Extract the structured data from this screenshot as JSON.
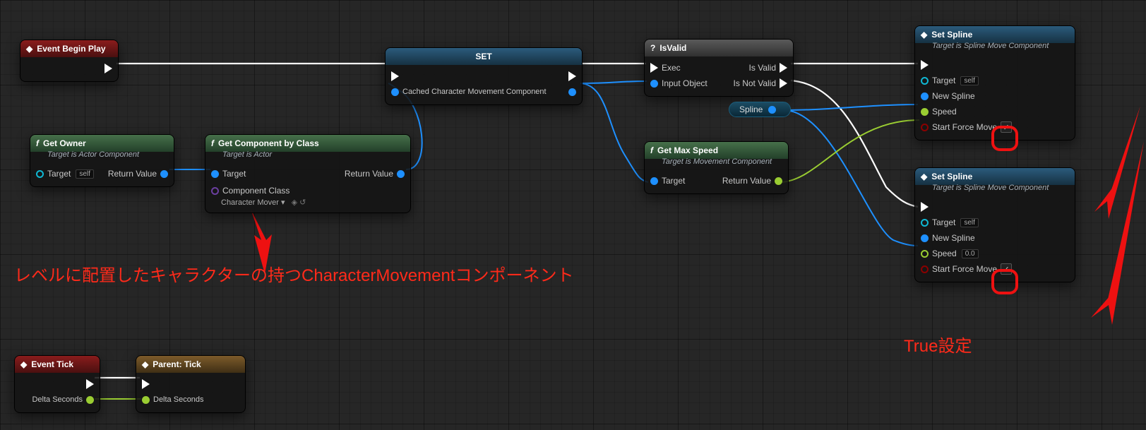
{
  "nodes": {
    "eventBeginPlay": {
      "title": "Event Begin Play"
    },
    "getOwner": {
      "title": "Get Owner",
      "subtitle": "Target is Actor Component",
      "targetLabel": "Target",
      "selfBadge": "self",
      "returnLabel": "Return Value"
    },
    "getComponent": {
      "title": "Get Component by Class",
      "subtitle": "Target is Actor",
      "targetLabel": "Target",
      "classLabel": "Component Class",
      "classValue": "Character Mover",
      "returnLabel": "Return Value"
    },
    "set": {
      "title": "SET",
      "varLabel": "Cached Character Movement Component"
    },
    "isValid": {
      "title": "IsValid",
      "execLabel": "Exec",
      "inputLabel": "Input Object",
      "validLabel": "Is Valid",
      "notValidLabel": "Is Not Valid"
    },
    "splineChip": {
      "label": "Spline"
    },
    "getMaxSpeed": {
      "title": "Get Max Speed",
      "subtitle": "Target is Movement Component",
      "targetLabel": "Target",
      "returnLabel": "Return Value"
    },
    "setSpline1": {
      "title": "Set Spline",
      "subtitle": "Target is Spline Move Component",
      "targetLabel": "Target",
      "selfBadge": "self",
      "splineLabel": "New Spline",
      "speedLabel": "Speed",
      "forceLabel": "Start Force Move"
    },
    "setSpline2": {
      "title": "Set Spline",
      "subtitle": "Target is Spline Move Component",
      "targetLabel": "Target",
      "selfBadge": "self",
      "splineLabel": "New Spline",
      "speedLabel": "Speed",
      "speedValue": "0.0",
      "forceLabel": "Start Force Move"
    },
    "eventTick": {
      "title": "Event Tick",
      "deltaLabel": "Delta Seconds"
    },
    "parentTick": {
      "title": "Parent: Tick",
      "deltaLabel": "Delta Seconds"
    }
  },
  "annotations": {
    "main": "レベルに配置したキャラクターの持つCharacterMovementコンポーネント",
    "trueSet": "True設定"
  }
}
